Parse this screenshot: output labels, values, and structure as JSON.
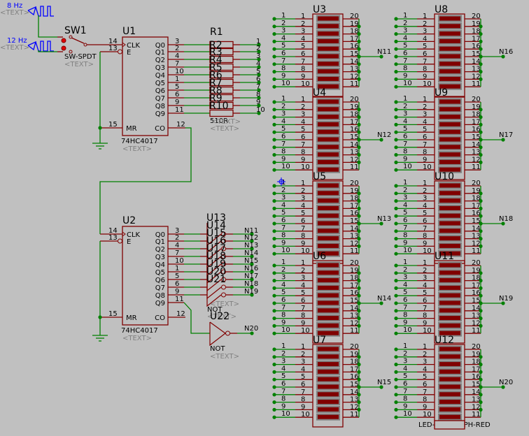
{
  "colors": {
    "background": "#c0c0c0",
    "component": "#800000",
    "wire": "#008000",
    "generator": "#0000ff",
    "placeholder_text": "#808080",
    "label": "#000000"
  },
  "generators": [
    {
      "freq": "8 Hz",
      "text": "<TEXT>"
    },
    {
      "freq": "12 Hz",
      "text": "<TEXT>"
    }
  ],
  "switch": {
    "ref": "SW1",
    "part": "SW-SPDT",
    "text": "<TEXT>"
  },
  "counters": [
    {
      "ref": "U1",
      "part": "74HC4017",
      "text": "<TEXT>"
    },
    {
      "ref": "U2",
      "part": "74HC4017",
      "text": "<TEXT>"
    }
  ],
  "counter_pins": {
    "clk": {
      "num": "14",
      "name": "CLK"
    },
    "e": {
      "num": "13",
      "name": "E"
    },
    "mr": {
      "num": "15",
      "name": "MR"
    },
    "co": {
      "num": "12",
      "name": "CO"
    },
    "outputs": [
      {
        "name": "Q0",
        "num": "3"
      },
      {
        "name": "Q1",
        "num": "2"
      },
      {
        "name": "Q2",
        "num": "4"
      },
      {
        "name": "Q3",
        "num": "7"
      },
      {
        "name": "Q4",
        "num": "10"
      },
      {
        "name": "Q5",
        "num": "1"
      },
      {
        "name": "Q6",
        "num": "5"
      },
      {
        "name": "Q7",
        "num": "6"
      },
      {
        "name": "Q8",
        "num": "9"
      },
      {
        "name": "Q9",
        "num": "11"
      }
    ]
  },
  "resistors": {
    "refs": [
      "R1",
      "R2",
      "R3",
      "R4",
      "R5",
      "R6",
      "R7",
      "R8",
      "R9",
      "R10"
    ],
    "value": "510R",
    "text": "<TEXT>",
    "nets": [
      "1",
      "2",
      "3",
      "4",
      "5",
      "6",
      "7",
      "8",
      "9",
      "10"
    ]
  },
  "inverters": {
    "refs": [
      "U13",
      "U14",
      "U15",
      "U16",
      "U17",
      "U18",
      "U19",
      "U20",
      "U21"
    ],
    "part": "NOT",
    "text": "<TEXT>",
    "nets": [
      "N11",
      "N12",
      "N13",
      "N14",
      "N15",
      "N16",
      "N17",
      "N18",
      "N19"
    ]
  },
  "inverter_single": {
    "ref": "U22",
    "part": "NOT",
    "text": "<TEXT>",
    "net": "N20"
  },
  "bargraph_part": "LED-BARGRAPH-RED",
  "bargraph_left_pins": [
    "1",
    "2",
    "3",
    "4",
    "5",
    "6",
    "7",
    "8",
    "9",
    "10"
  ],
  "bargraph_right_pins": [
    "20",
    "19",
    "18",
    "17",
    "16",
    "15",
    "14",
    "13",
    "12",
    "11"
  ],
  "bargraph_inputs": [
    "1",
    "2",
    "3",
    "4",
    "5",
    "6",
    "7",
    "8",
    "9",
    "10"
  ],
  "bargraphs": [
    {
      "ref": "U3",
      "net": "N11"
    },
    {
      "ref": "U4",
      "net": "N12"
    },
    {
      "ref": "U5",
      "net": "N13"
    },
    {
      "ref": "U6",
      "net": "N14"
    },
    {
      "ref": "U7",
      "net": "N15"
    },
    {
      "ref": "U8",
      "net": "N16"
    },
    {
      "ref": "U9",
      "net": "N17"
    },
    {
      "ref": "U10",
      "net": "N18"
    },
    {
      "ref": "U11",
      "net": "N19"
    },
    {
      "ref": "U12",
      "net": "N20"
    }
  ]
}
